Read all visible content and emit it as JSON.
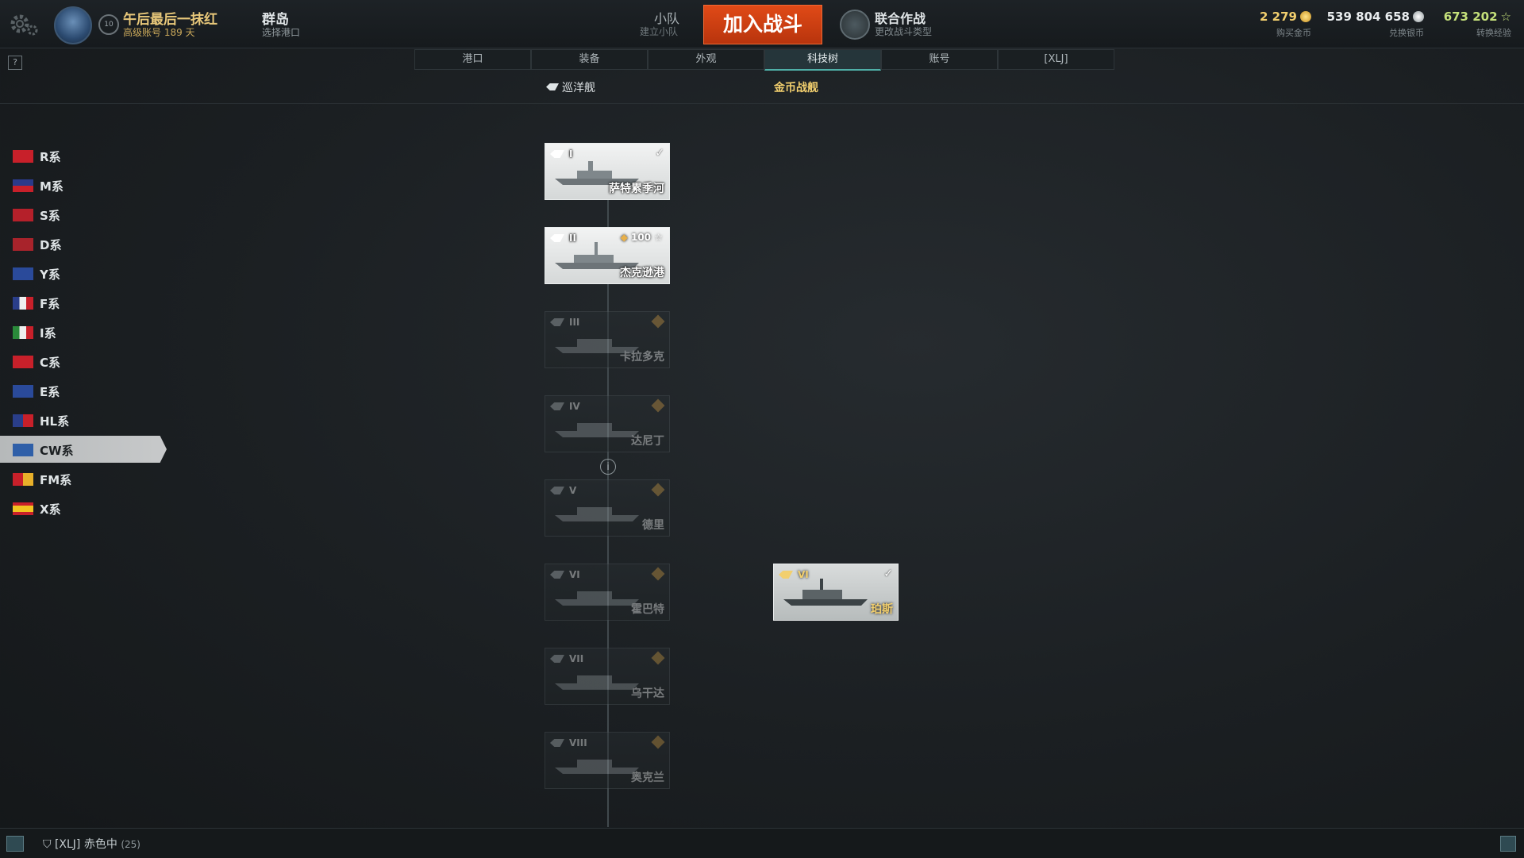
{
  "header": {
    "account_name": "午后最后一抹红",
    "account_sub": "高级账号 189 天",
    "rank_level": "10",
    "port_name": "群岛",
    "port_sub": "选择港口",
    "squad_label": "小队",
    "squad_sub": "建立小队",
    "battle_button": "加入战斗",
    "mode_label": "联合作战",
    "mode_sub": "更改战斗类型",
    "gold_value": "2 279",
    "gold_sub": "购买金币",
    "silver_value": "539 804 658",
    "silver_sub": "兑换银币",
    "xp_value": "673 202",
    "xp_sub": "转换经验"
  },
  "help_label": "?",
  "tabs": [
    {
      "label": "港口"
    },
    {
      "label": "装备"
    },
    {
      "label": "外观"
    },
    {
      "label": "科技树"
    },
    {
      "label": "账号"
    },
    {
      "label": "[XLJ]"
    }
  ],
  "subnav": {
    "cruiser_label": "巡洋舰",
    "premium_label": "金币战舰"
  },
  "nations": [
    {
      "label": "R系"
    },
    {
      "label": "M系"
    },
    {
      "label": "S系"
    },
    {
      "label": "D系"
    },
    {
      "label": "Y系"
    },
    {
      "label": "F系"
    },
    {
      "label": "I系"
    },
    {
      "label": "C系"
    },
    {
      "label": "E系"
    },
    {
      "label": "HL系"
    },
    {
      "label": "CW系"
    },
    {
      "label": "FM系"
    },
    {
      "label": "X系"
    }
  ],
  "ships": [
    {
      "tier": "I",
      "name": "萨特累季河",
      "status": "researched"
    },
    {
      "tier": "II",
      "name": "杰克逊港",
      "status": "available",
      "cost": "100"
    },
    {
      "tier": "III",
      "name": "卡拉多克",
      "status": "locked"
    },
    {
      "tier": "IV",
      "name": "达尼丁",
      "status": "locked"
    },
    {
      "tier": "V",
      "name": "德里",
      "status": "locked"
    },
    {
      "tier": "VI",
      "name": "霍巴特",
      "status": "locked"
    },
    {
      "tier": "VII",
      "name": "乌干达",
      "status": "locked"
    },
    {
      "tier": "VIII",
      "name": "奥克兰",
      "status": "locked"
    }
  ],
  "premium_ship": {
    "tier": "VI",
    "name": "珀斯",
    "status": "researched"
  },
  "info_label": "i",
  "bottom": {
    "clan_tag": "[XLJ]",
    "clan_status": "赤色中",
    "clan_count": "(25)"
  },
  "colors": {
    "battle_button": "#d2421a",
    "gold": "#f2cf6e",
    "xp": "#c4e07a",
    "selected_nation": "#c0c3c4",
    "active_tab_accent": "#4fb0a8"
  },
  "icons": {
    "settings": "gear-icon",
    "info": "info-icon",
    "chat": "chat-icon",
    "notification": "bell-icon",
    "checkmark": "check-icon",
    "star": "star-icon"
  }
}
